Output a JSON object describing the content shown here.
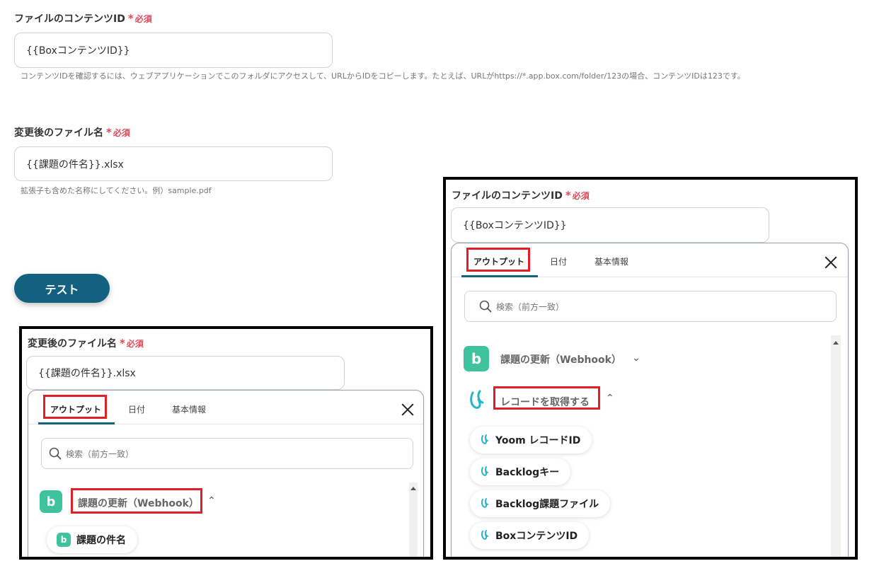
{
  "form": {
    "content_id_label": "ファイルのコンテンツID",
    "required": "必須",
    "content_id_value": "{{BoxコンテンツID}}",
    "content_id_help": "コンテンツIDを確認するには、ウェブアプリケーションでこのフォルダにアクセスして、URLからIDをコピーします。たとえば、URLがhttps://*.app.box.com/folder/123の場合、コンテンツIDは123です。",
    "filename_label": "変更後のファイル名",
    "filename_value": "{{課題の件名}}.xlsx",
    "filename_help": "拡張子も含めた名称にしてください。例）sample.pdf",
    "test_button": "テスト"
  },
  "left_panel": {
    "label": "変更後のファイル名",
    "required": "必須",
    "input_value": "{{課題の件名}}.xlsx",
    "tabs": [
      "アウトプット",
      "日付",
      "基本情報"
    ],
    "search_placeholder": "検索（前方一致）",
    "section_title": "課題の更新（Webhook）",
    "chip": "課題の件名"
  },
  "right_panel": {
    "label": "ファイルのコンテンツID",
    "required": "必須",
    "input_value": "{{BoxコンテンツID}}",
    "tabs": [
      "アウトプット",
      "日付",
      "基本情報"
    ],
    "search_placeholder": "検索（前方一致）",
    "section1_title": "課題の更新（Webhook）",
    "section2_title": "レコードを取得する",
    "chips": [
      "Yoom レコードID",
      "Backlogキー",
      "Backlog課題ファイル",
      "BoxコンテンツID"
    ]
  },
  "colors": {
    "accent": "#13607f",
    "required": "#e0475a",
    "highlight": "#e01f26",
    "backlog_green": "#3ec39e",
    "yoom_teal": "#25b5c9"
  },
  "icons": {
    "search": "search-icon",
    "close": "close-icon",
    "backlog": "backlog-icon",
    "yoom": "yoom-icon"
  }
}
